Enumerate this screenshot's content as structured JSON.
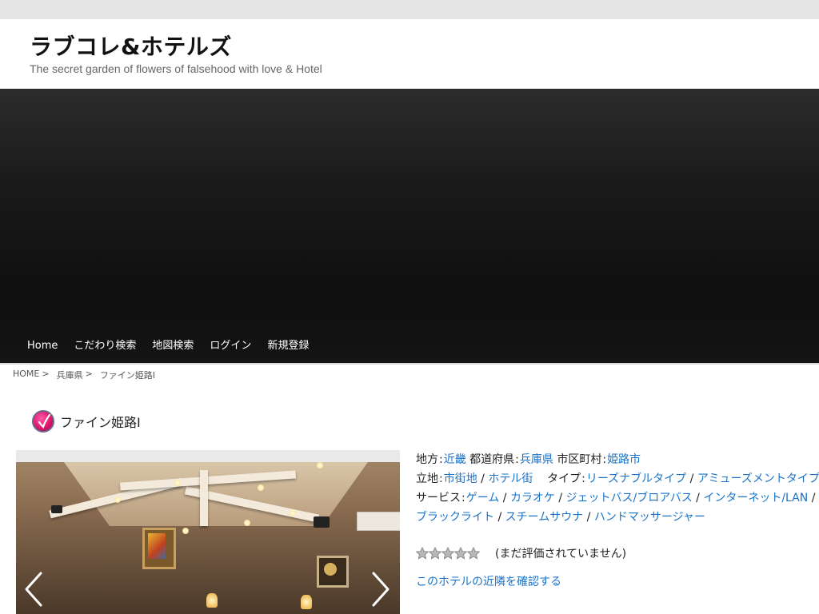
{
  "site": {
    "title": "ラブコレ&ホテルズ",
    "tagline": "The secret garden of flowers of falsehood with love & Hotel"
  },
  "nav": {
    "items": [
      {
        "label": "Home"
      },
      {
        "label": "こだわり検索"
      },
      {
        "label": "地図検索"
      },
      {
        "label": "ログイン"
      },
      {
        "label": "新規登録"
      }
    ]
  },
  "breadcrumb": {
    "home": "HOME",
    "prefecture": "兵庫県",
    "current": "ファイン姫路Ⅰ",
    "separator": ">"
  },
  "hotel": {
    "name": "ファイン姫路Ⅰ",
    "region_label": "地方",
    "region": "近畿",
    "prefecture_label": "都道府県",
    "prefecture": "兵庫県",
    "city_label": "市区町村",
    "city": "姫路市",
    "location_label": "立地",
    "locations": [
      "市街地",
      "ホテル街"
    ],
    "type_label": "タイプ",
    "types": [
      "リーズナブルタイプ",
      "アミューズメントタイプ"
    ],
    "services_label": "サービス",
    "services": [
      "ゲーム",
      "カラオケ",
      "ジェットバス/ブロアバス",
      "インターネット/LAN",
      "ブラックライト",
      "スチームサウナ",
      "ハンドマッサージャー"
    ],
    "colon": ":",
    "list_separator": "/"
  },
  "rating": {
    "value": 0,
    "max": 5,
    "text": "(まだ評価されていません)"
  },
  "nearby_link": "このホテルの近隣を確認する",
  "icons": {
    "heading": "hotel-logo-icon",
    "prev": "chevron-left-icon",
    "next": "chevron-right-icon",
    "star": "star-icon"
  },
  "colors": {
    "link": "#1a73c8",
    "hero": "#111111",
    "topbar": "#e4e4e4"
  }
}
